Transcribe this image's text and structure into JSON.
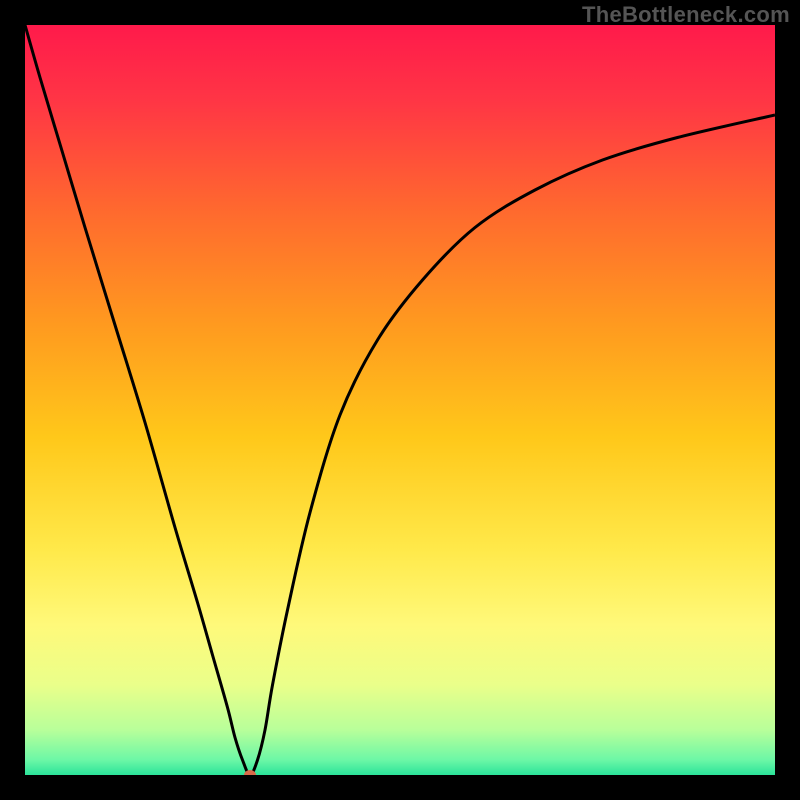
{
  "watermark": "TheBottleneck.com",
  "chart_data": {
    "type": "line",
    "title": "",
    "xlabel": "",
    "ylabel": "",
    "xlim": [
      0,
      100
    ],
    "ylim": [
      0,
      100
    ],
    "grid": false,
    "legend": false,
    "background_gradient": {
      "stops": [
        {
          "offset": 0.0,
          "color": "#ff1a4b"
        },
        {
          "offset": 0.1,
          "color": "#ff3545"
        },
        {
          "offset": 0.25,
          "color": "#ff6a2e"
        },
        {
          "offset": 0.4,
          "color": "#ff9a1f"
        },
        {
          "offset": 0.55,
          "color": "#ffc81a"
        },
        {
          "offset": 0.7,
          "color": "#ffe94a"
        },
        {
          "offset": 0.8,
          "color": "#fff97a"
        },
        {
          "offset": 0.88,
          "color": "#eaff8a"
        },
        {
          "offset": 0.94,
          "color": "#b8ff9a"
        },
        {
          "offset": 0.98,
          "color": "#6cf7a6"
        },
        {
          "offset": 1.0,
          "color": "#2be39a"
        }
      ]
    },
    "series": [
      {
        "name": "curve",
        "color": "#000000",
        "x": [
          0,
          2,
          5,
          8,
          12,
          16,
          20,
          23,
          25,
          27,
          28,
          29,
          30,
          31,
          32,
          33,
          35,
          38,
          42,
          47,
          53,
          60,
          68,
          77,
          87,
          100
        ],
        "y": [
          100,
          93,
          83,
          73,
          60,
          47,
          33,
          23,
          16,
          9,
          5,
          2,
          0,
          2,
          6,
          12,
          22,
          35,
          48,
          58,
          66,
          73,
          78,
          82,
          85,
          88
        ]
      }
    ],
    "marker": {
      "x": 30,
      "y": 0,
      "color": "#d96a4a",
      "rx": 6,
      "ry": 5
    }
  }
}
